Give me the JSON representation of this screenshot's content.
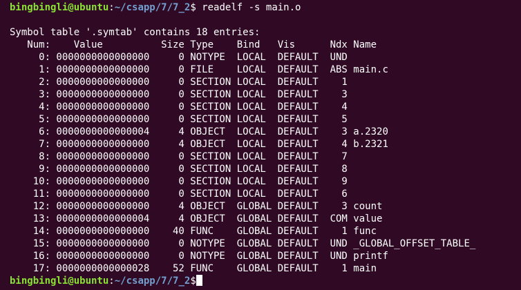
{
  "session": {
    "user_host": "bingbingli@ubuntu",
    "separator": ":",
    "cwd": "~/csapp/7/7_2",
    "prompt_symbol": "$",
    "command": " readelf -s main.o"
  },
  "output": {
    "blank": "",
    "table_title": "Symbol table '.symtab' contains 18 entries:",
    "header": "   Num:    Value          Size Type    Bind   Vis      Ndx Name",
    "rows": [
      "     0: 0000000000000000     0 NOTYPE  LOCAL  DEFAULT  UND ",
      "     1: 0000000000000000     0 FILE    LOCAL  DEFAULT  ABS main.c",
      "     2: 0000000000000000     0 SECTION LOCAL  DEFAULT    1 ",
      "     3: 0000000000000000     0 SECTION LOCAL  DEFAULT    3 ",
      "     4: 0000000000000000     0 SECTION LOCAL  DEFAULT    4 ",
      "     5: 0000000000000000     0 SECTION LOCAL  DEFAULT    5 ",
      "     6: 0000000000000004     4 OBJECT  LOCAL  DEFAULT    3 a.2320",
      "     7: 0000000000000000     4 OBJECT  LOCAL  DEFAULT    4 b.2321",
      "     8: 0000000000000000     0 SECTION LOCAL  DEFAULT    7 ",
      "     9: 0000000000000000     0 SECTION LOCAL  DEFAULT    8 ",
      "    10: 0000000000000000     0 SECTION LOCAL  DEFAULT    9 ",
      "    11: 0000000000000000     0 SECTION LOCAL  DEFAULT    6 ",
      "    12: 0000000000000000     4 OBJECT  GLOBAL DEFAULT    3 count",
      "    13: 0000000000000004     4 OBJECT  GLOBAL DEFAULT  COM value",
      "    14: 0000000000000000    40 FUNC    GLOBAL DEFAULT    1 func",
      "    15: 0000000000000000     0 NOTYPE  GLOBAL DEFAULT  UND _GLOBAL_OFFSET_TABLE_",
      "    16: 0000000000000000     0 NOTYPE  GLOBAL DEFAULT  UND printf",
      "    17: 0000000000000028    52 FUNC    GLOBAL DEFAULT    1 main"
    ]
  },
  "colors": {
    "background": "#300a24",
    "text": "#ffffff",
    "prompt_user": "#8ae234",
    "prompt_path": "#729fcf"
  }
}
